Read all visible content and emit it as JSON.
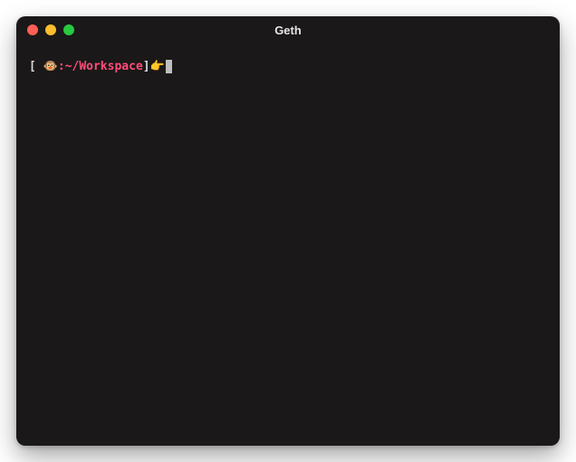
{
  "window": {
    "title": "Geth"
  },
  "prompt": {
    "bracket_open": "[ ",
    "symbol": "🐵",
    "sep": ":",
    "path": "~/Workspace",
    "bracket_close": "]",
    "pointer": "👉"
  }
}
